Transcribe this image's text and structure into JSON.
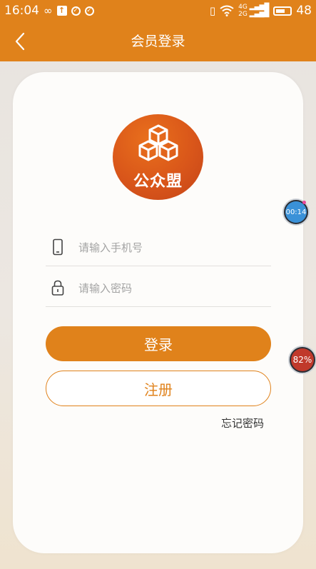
{
  "status_bar": {
    "time": "16:04",
    "battery_level": "48",
    "signal_label_top": "4G",
    "signal_label_bottom": "2G"
  },
  "nav": {
    "title": "会员登录"
  },
  "logo": {
    "brand_text": "公众盟"
  },
  "form": {
    "phone_placeholder": "请输入手机号",
    "password_placeholder": "请输入密码",
    "login_label": "登录",
    "register_label": "注册",
    "forgot_label": "忘记密码"
  },
  "floating": {
    "timer_text": "00:14",
    "battery_text": "82%"
  },
  "colors": {
    "accent": "#e0821b",
    "logo": "#d9561a"
  }
}
